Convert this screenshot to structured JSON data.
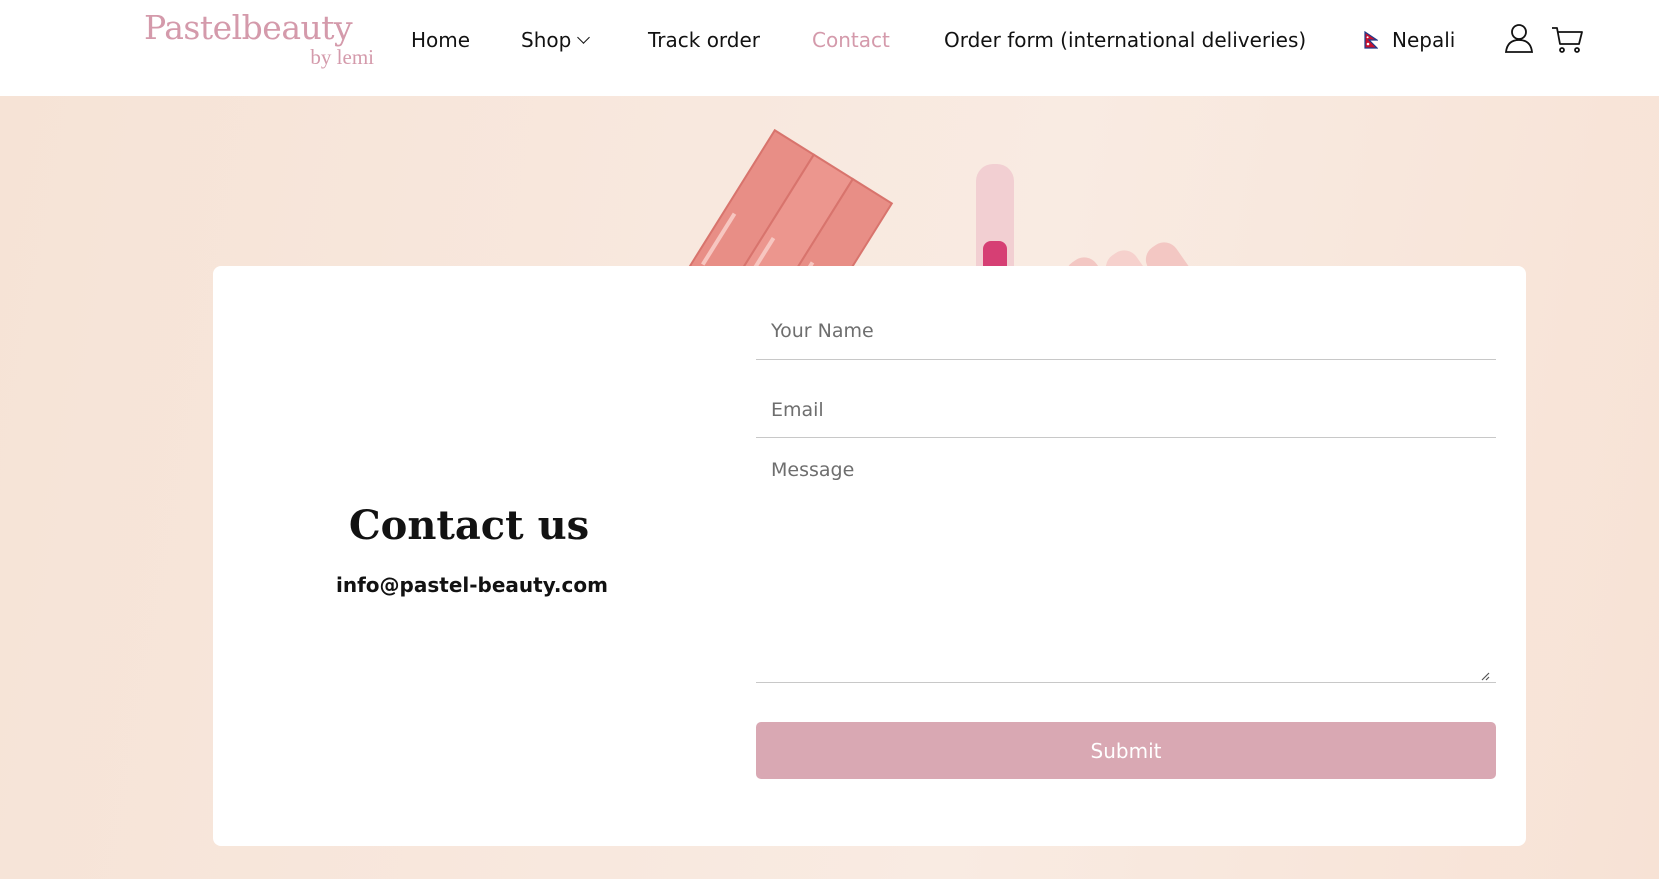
{
  "brand": {
    "name": "Pastelbeauty",
    "tagline": "by lemi"
  },
  "nav": {
    "items": [
      {
        "label": "Home"
      },
      {
        "label": "Shop"
      },
      {
        "label": "Track order"
      },
      {
        "label": "Contact"
      },
      {
        "label": "Order form (international deliveries)"
      }
    ],
    "active": "Contact",
    "language": "Nepali"
  },
  "icons": {
    "account": "account-icon",
    "cart": "cart-icon",
    "flag": "nepal-flag-icon",
    "dropdown": "chevron-down-icon"
  },
  "contact": {
    "title": "Contact us",
    "email": "info@pastel-beauty.com"
  },
  "form": {
    "name_placeholder": "Your Name",
    "email_placeholder": "Email",
    "message_placeholder": "Message",
    "submit_label": "Submit"
  },
  "colors": {
    "accent": "#d49aab",
    "button": "#d9a8b3",
    "hero_background": "#f8e8de"
  }
}
